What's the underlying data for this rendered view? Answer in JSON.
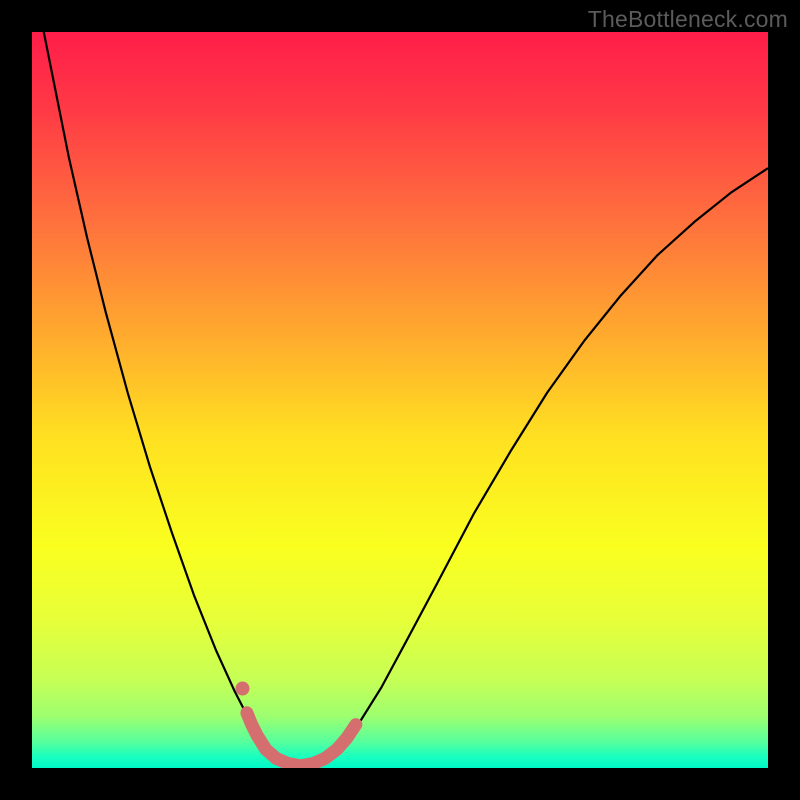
{
  "watermark": "TheBottleneck.com",
  "gradient": {
    "stops": [
      {
        "offset": 0.0,
        "color": "#ff1d49"
      },
      {
        "offset": 0.1,
        "color": "#ff3846"
      },
      {
        "offset": 0.25,
        "color": "#ff6e3e"
      },
      {
        "offset": 0.4,
        "color": "#ffa62f"
      },
      {
        "offset": 0.55,
        "color": "#ffe021"
      },
      {
        "offset": 0.7,
        "color": "#faff1f"
      },
      {
        "offset": 0.8,
        "color": "#e6ff3a"
      },
      {
        "offset": 0.88,
        "color": "#c6ff55"
      },
      {
        "offset": 0.93,
        "color": "#9dff70"
      },
      {
        "offset": 0.965,
        "color": "#55ff9e"
      },
      {
        "offset": 0.985,
        "color": "#19ffc0"
      },
      {
        "offset": 1.0,
        "color": "#00f8c6"
      }
    ]
  },
  "chart_data": {
    "type": "line",
    "title": "",
    "xlabel": "",
    "ylabel": "",
    "xlim": [
      0,
      1
    ],
    "ylim": [
      0,
      1
    ],
    "series": [
      {
        "name": "bottleneck-curve",
        "color": "#000000",
        "width": 2.2,
        "points": [
          [
            0.0,
            1.09
          ],
          [
            0.012,
            1.02
          ],
          [
            0.03,
            0.93
          ],
          [
            0.05,
            0.83
          ],
          [
            0.075,
            0.72
          ],
          [
            0.1,
            0.62
          ],
          [
            0.13,
            0.51
          ],
          [
            0.16,
            0.41
          ],
          [
            0.19,
            0.32
          ],
          [
            0.22,
            0.235
          ],
          [
            0.25,
            0.16
          ],
          [
            0.275,
            0.105
          ],
          [
            0.295,
            0.066
          ],
          [
            0.31,
            0.042
          ],
          [
            0.325,
            0.024
          ],
          [
            0.34,
            0.011
          ],
          [
            0.355,
            0.004
          ],
          [
            0.37,
            0.001
          ],
          [
            0.385,
            0.004
          ],
          [
            0.4,
            0.012
          ],
          [
            0.42,
            0.03
          ],
          [
            0.445,
            0.062
          ],
          [
            0.475,
            0.11
          ],
          [
            0.51,
            0.175
          ],
          [
            0.55,
            0.25
          ],
          [
            0.6,
            0.345
          ],
          [
            0.65,
            0.43
          ],
          [
            0.7,
            0.51
          ],
          [
            0.75,
            0.58
          ],
          [
            0.8,
            0.642
          ],
          [
            0.85,
            0.697
          ],
          [
            0.9,
            0.742
          ],
          [
            0.95,
            0.782
          ],
          [
            1.0,
            0.815
          ]
        ]
      },
      {
        "name": "highlight-band",
        "color": "#d56f6f",
        "width": 13,
        "linecap": "round",
        "points": [
          [
            0.292,
            0.075
          ],
          [
            0.298,
            0.06
          ],
          [
            0.306,
            0.044
          ],
          [
            0.318,
            0.025
          ],
          [
            0.332,
            0.013
          ],
          [
            0.348,
            0.006
          ],
          [
            0.365,
            0.003
          ],
          [
            0.382,
            0.006
          ],
          [
            0.398,
            0.013
          ],
          [
            0.414,
            0.025
          ],
          [
            0.428,
            0.041
          ],
          [
            0.44,
            0.059
          ]
        ]
      },
      {
        "name": "highlight-dot",
        "color": "#d56f6f",
        "type": "scatter",
        "radius": 7,
        "points": [
          [
            0.286,
            0.108
          ]
        ]
      }
    ]
  }
}
